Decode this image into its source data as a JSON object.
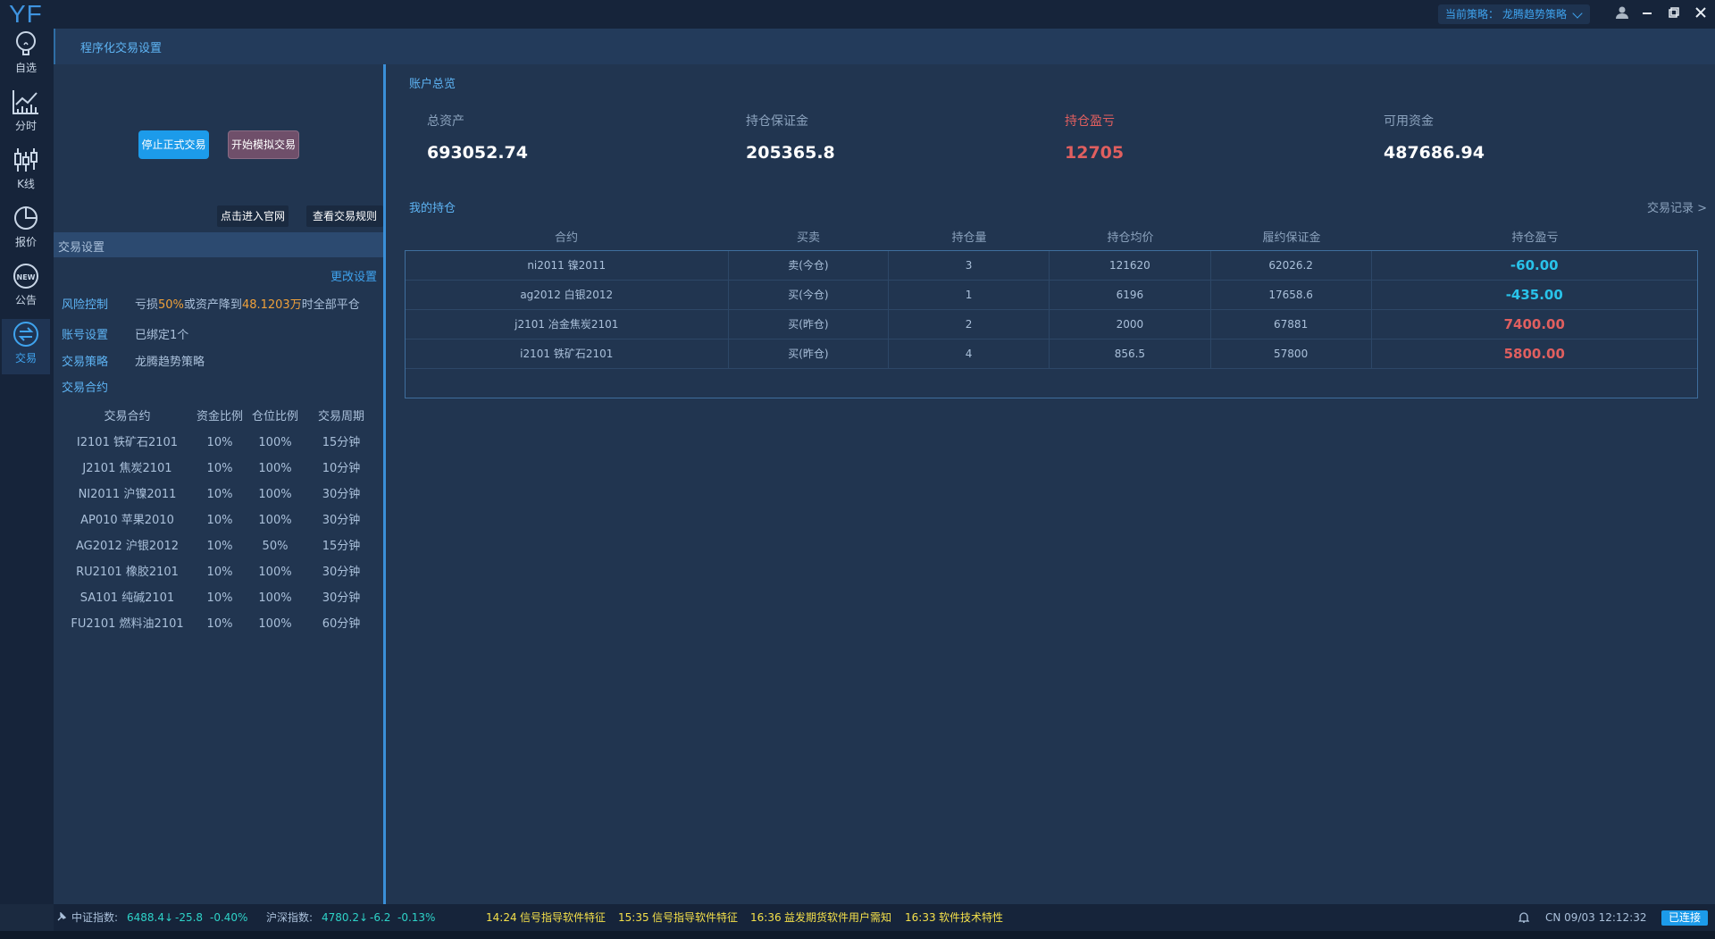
{
  "app": {
    "logo": "YF"
  },
  "topbar": {
    "strategy_label": "当前策略：",
    "strategy_value": "龙腾趋势策略"
  },
  "nav": [
    {
      "label": "自选",
      "icon": "lightbulb-icon"
    },
    {
      "label": "分时",
      "icon": "line-chart-icon"
    },
    {
      "label": "K线",
      "icon": "candlestick-icon"
    },
    {
      "label": "报价",
      "icon": "pie-chart-icon"
    },
    {
      "label": "公告",
      "icon": "new-badge-icon"
    },
    {
      "label": "交易",
      "icon": "exchange-icon",
      "active": true
    }
  ],
  "page": {
    "title": "程序化交易设置"
  },
  "left": {
    "stop_live_button": "停止正式交易",
    "start_sim_button": "开始模拟交易",
    "official_site_button": "点击进入官网",
    "rules_button": "查看交易规则",
    "section_title": "交易设置",
    "edit_link": "更改设置",
    "risk_key": "风险控制",
    "risk_text_1": "亏损",
    "risk_pct": "50%",
    "risk_text_2": "或资产降到",
    "risk_amount": "48.1203万",
    "risk_text_3": "时全部平仓",
    "account_key": "账号设置",
    "account_val": "已绑定1个",
    "strategy_key": "交易策略",
    "strategy_val": "龙腾趋势策略",
    "contracts_key": "交易合约",
    "contract_headers": [
      "交易合约",
      "资金比例",
      "仓位比例",
      "交易周期"
    ],
    "contracts": [
      [
        "I2101  铁矿石2101",
        "10%",
        "100%",
        "15分钟"
      ],
      [
        "J2101  焦炭2101",
        "10%",
        "100%",
        "10分钟"
      ],
      [
        "NI2011  沪镍2011",
        "10%",
        "100%",
        "30分钟"
      ],
      [
        "AP010  苹果2010",
        "10%",
        "100%",
        "30分钟"
      ],
      [
        "AG2012  沪银2012",
        "10%",
        "50%",
        "15分钟"
      ],
      [
        "RU2101  橡胶2101",
        "10%",
        "100%",
        "30分钟"
      ],
      [
        "SA101  纯碱2101",
        "10%",
        "100%",
        "30分钟"
      ],
      [
        "FU2101  燃料油2101",
        "10%",
        "100%",
        "60分钟"
      ]
    ]
  },
  "overview": {
    "title": "账户总览",
    "total_assets_label": "总资产",
    "total_assets": "693052.74",
    "margin_label": "持仓保证金",
    "margin": "205365.8",
    "pnl_label": "持仓盈亏",
    "pnl": "12705",
    "available_label": "可用资金",
    "available": "487686.94"
  },
  "holdings": {
    "title": "我的持仓",
    "records_link": "交易记录 >",
    "headers": [
      "合约",
      "买卖",
      "持仓量",
      "持仓均价",
      "履约保证金",
      "持仓盈亏"
    ],
    "rows": [
      {
        "contract": "ni2011 镍2011",
        "side": "卖(今仓)",
        "qty": "3",
        "avg": "121620",
        "margin": "62026.2",
        "pnl": "-60.00"
      },
      {
        "contract": "ag2012 白银2012",
        "side": "买(今仓)",
        "qty": "1",
        "avg": "6196",
        "margin": "17658.6",
        "pnl": "-435.00"
      },
      {
        "contract": "j2101 冶金焦炭2101",
        "side": "买(昨仓)",
        "qty": "2",
        "avg": "2000",
        "margin": "67881",
        "pnl": "7400.00"
      },
      {
        "contract": "i2101 铁矿石2101",
        "side": "买(昨仓)",
        "qty": "4",
        "avg": "856.5",
        "margin": "57800",
        "pnl": "5800.00"
      }
    ]
  },
  "status": {
    "idx1_label": "中证指数:",
    "idx1_val": "6488.4↓",
    "idx1_chg": "-25.8",
    "idx1_pct": "-0.40%",
    "idx2_label": "沪深指数:",
    "idx2_val": "4780.2↓",
    "idx2_chg": "-6.2",
    "idx2_pct": "-0.13%",
    "news": [
      {
        "time": "14:24",
        "text": "信号指导软件特征"
      },
      {
        "time": "15:35",
        "text": "信号指导软件特征"
      },
      {
        "time": "16:36",
        "text": "益发期货软件用户需知"
      },
      {
        "time": "16:33",
        "text": "软件技术特性"
      }
    ],
    "clock": "CN 09/03 12:12:32",
    "connection": "已连接"
  }
}
